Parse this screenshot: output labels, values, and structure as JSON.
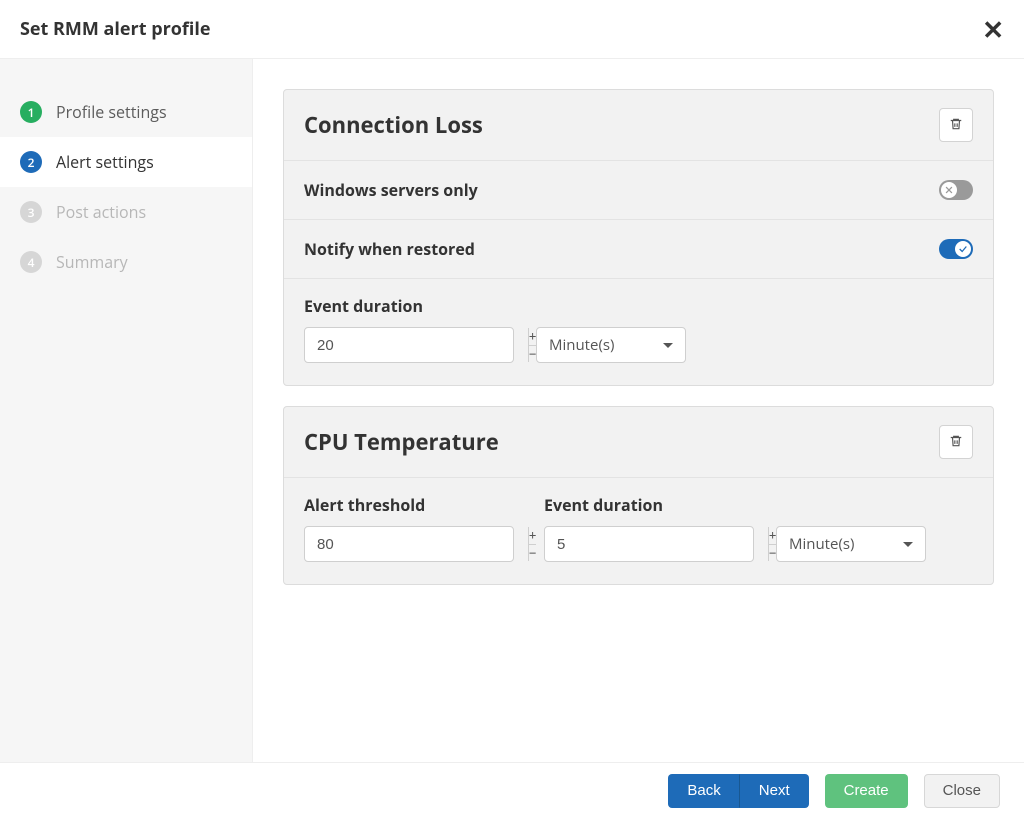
{
  "title": "Set RMM alert profile",
  "steps": [
    {
      "label": "Profile settings"
    },
    {
      "label": "Alert settings"
    },
    {
      "label": "Post actions"
    },
    {
      "label": "Summary"
    }
  ],
  "cards": {
    "connection_loss": {
      "title": "Connection Loss",
      "windows_only_label": "Windows servers only",
      "windows_only": false,
      "notify_restored_label": "Notify when restored",
      "notify_restored": true,
      "event_duration_label": "Event duration",
      "event_duration_value": "20",
      "event_duration_unit": "Minute(s)"
    },
    "cpu_temperature": {
      "title": "CPU Temperature",
      "alert_threshold_label": "Alert threshold",
      "alert_threshold_value": "80",
      "event_duration_label": "Event duration",
      "event_duration_value": "5",
      "event_duration_unit": "Minute(s)"
    }
  },
  "footer": {
    "back": "Back",
    "next": "Next",
    "create": "Create",
    "close": "Close"
  }
}
